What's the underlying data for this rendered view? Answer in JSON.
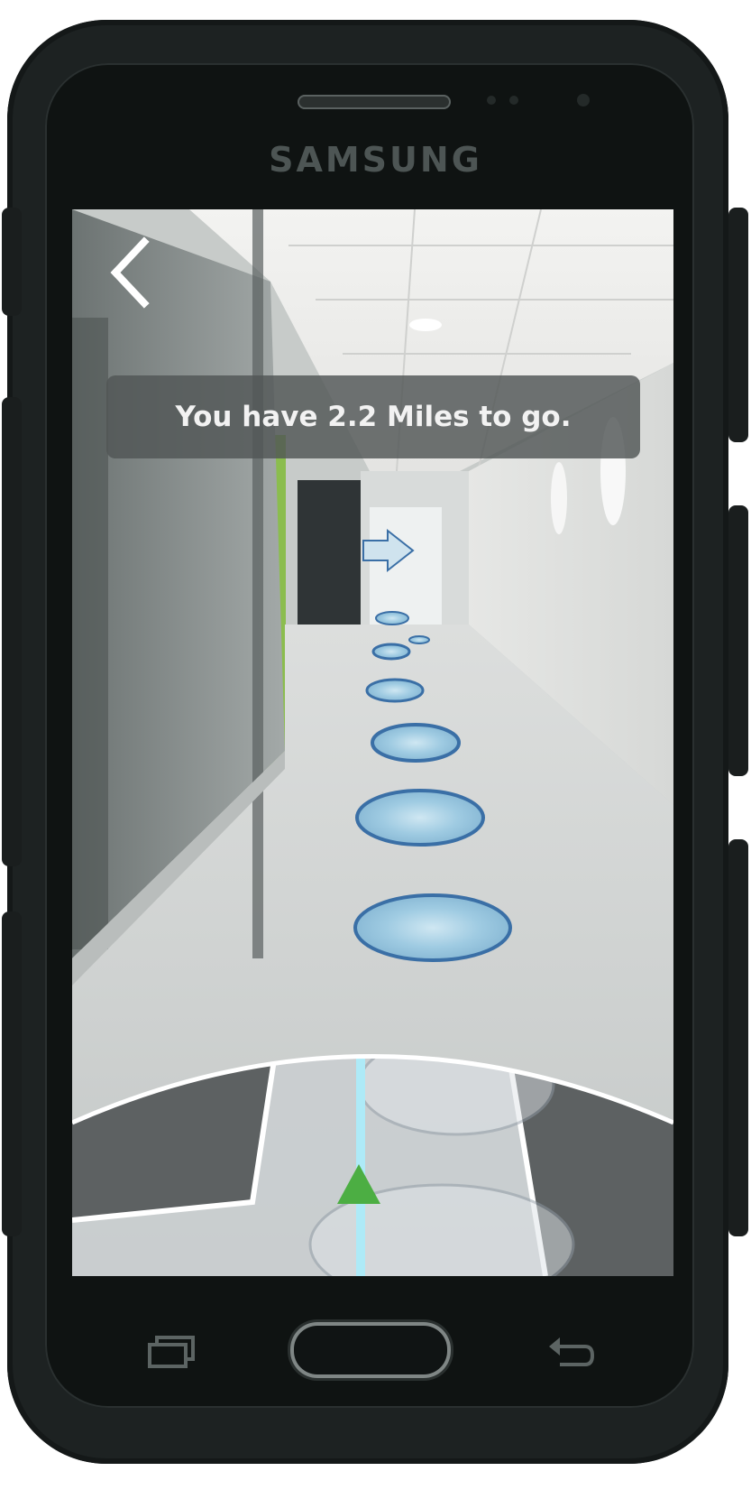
{
  "device": {
    "brand": "SAMSUNG"
  },
  "screen": {
    "banner_text": "You have 2.2 Miles to go.",
    "back_icon": "chevron-left-icon",
    "direction_icon": "arrow-right-icon",
    "waypoint_icon": "ellipse-waypoint",
    "position_icon": "triangle-position-icon",
    "colors": {
      "waypoint_fill": "#9fcbe2",
      "waypoint_stroke": "#3a6fa6",
      "route_line": "#aeeaf7",
      "position_marker": "#4cae43",
      "banner_bg": "#55595a",
      "map_dark": "#5d6162",
      "map_light": "#c9cdd0"
    }
  },
  "system_bar": {
    "recents_icon": "recents-icon",
    "home_button": "home-button",
    "back_icon": "android-back-icon"
  }
}
